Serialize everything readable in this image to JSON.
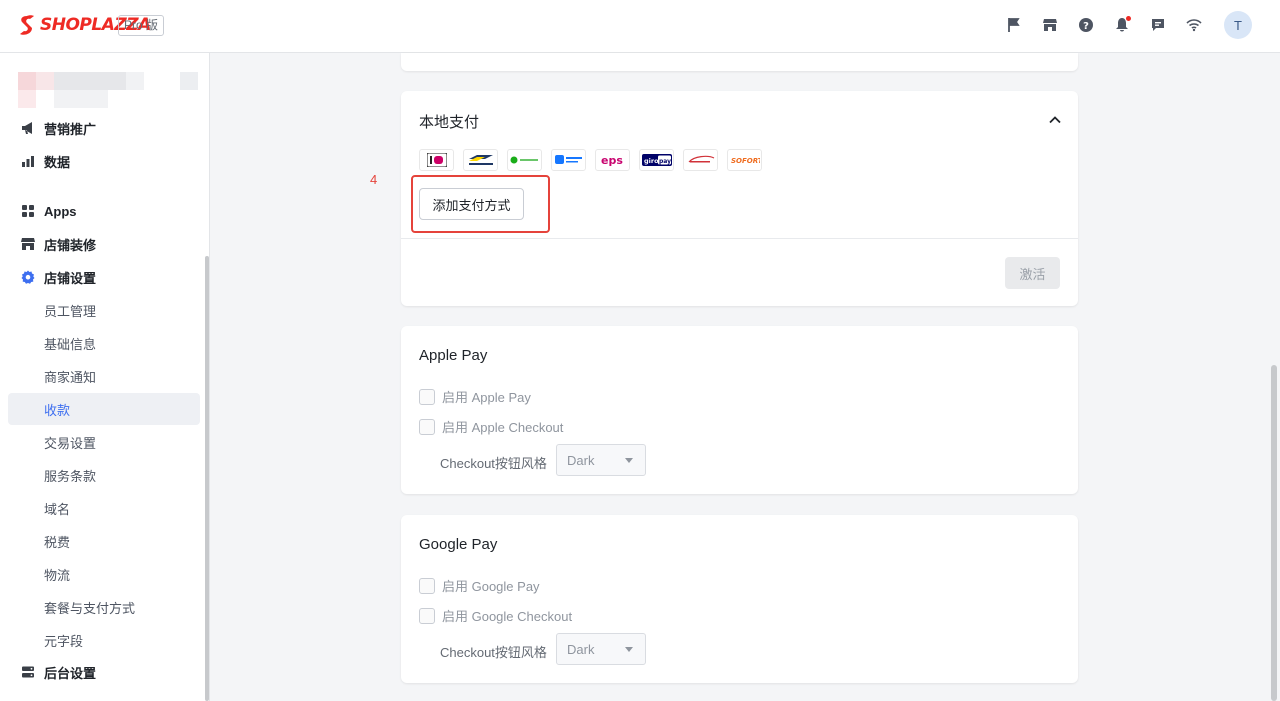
{
  "header": {
    "brand": "SHOPLAZZA",
    "plan_badge": "Pro 版",
    "icons": [
      "flag-icon",
      "store-icon",
      "help-icon",
      "bell-icon",
      "message-icon",
      "wifi-icon"
    ],
    "avatar_initial": "T"
  },
  "sidebar": {
    "items": [
      {
        "label": "营销推广",
        "icon": "megaphone-icon"
      },
      {
        "label": "数据",
        "icon": "bar-chart-icon"
      },
      {
        "label": "Apps",
        "icon": "apps-grid-icon"
      },
      {
        "label": "店铺装修",
        "icon": "store-icon"
      },
      {
        "label": "店铺设置",
        "icon": "gear-icon"
      },
      {
        "label": "员工管理"
      },
      {
        "label": "基础信息"
      },
      {
        "label": "商家通知"
      },
      {
        "label": "收款"
      },
      {
        "label": "交易设置"
      },
      {
        "label": "服务条款"
      },
      {
        "label": "域名"
      },
      {
        "label": "税费"
      },
      {
        "label": "物流"
      },
      {
        "label": "套餐与支付方式"
      },
      {
        "label": "元字段"
      },
      {
        "label": "后台设置",
        "icon": "server-icon"
      }
    ],
    "active": "收款"
  },
  "local_payment": {
    "title": "本地支付",
    "logos": [
      "iDEAL",
      "Bancontact",
      "WeChat Pay",
      "支付宝",
      "eps",
      "giropay",
      "Przelewy24",
      "SOFORT"
    ],
    "add_button": "添加支付方式",
    "activate_button": "激活",
    "step_number": "4"
  },
  "apple_pay": {
    "title": "Apple Pay",
    "enable_pay": "启用 Apple Pay",
    "enable_checkout": "启用 Apple Checkout",
    "style_label": "Checkout按钮风格",
    "style_value": "Dark"
  },
  "google_pay": {
    "title": "Google Pay",
    "enable_pay": "启用 Google Pay",
    "enable_checkout": "启用 Google Checkout",
    "style_label": "Checkout按钮风格",
    "style_value": "Dark"
  },
  "colors": {
    "brand": "#ee2a24",
    "accent": "#3e6ff0",
    "highlight": "#e5433b"
  }
}
